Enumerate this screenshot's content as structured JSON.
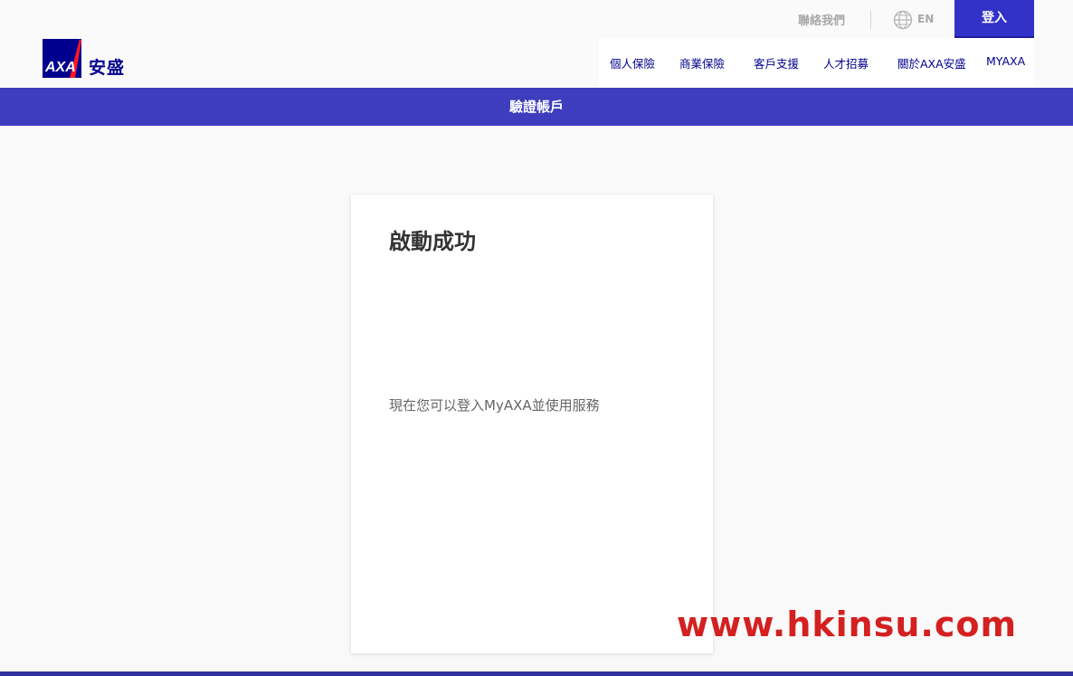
{
  "header": {
    "logo": {
      "mark_text": "AXA",
      "brand_text": "安盛"
    },
    "utility": {
      "contact_label": "聯絡我們",
      "language_label": "EN",
      "login_label": "登入"
    },
    "nav": {
      "items": [
        {
          "label": "個人保險"
        },
        {
          "label": "商業保險"
        },
        {
          "label": "客戶支援"
        },
        {
          "label": "人才招募"
        },
        {
          "label": "關於AXA安盛"
        },
        {
          "label": "MYAXA"
        }
      ]
    }
  },
  "band": {
    "title": "驗證帳戶"
  },
  "card": {
    "title": "啟動成功",
    "message": "現在您可以登入MyAXA並使用服務"
  },
  "watermark": {
    "text": "www.hkinsu.com"
  },
  "colors": {
    "brand_blue": "#00008f",
    "band_purple": "#3d3dbd",
    "login_button": "#3232c8",
    "axa_red": "#ff1721",
    "watermark_red": "#d42020"
  }
}
